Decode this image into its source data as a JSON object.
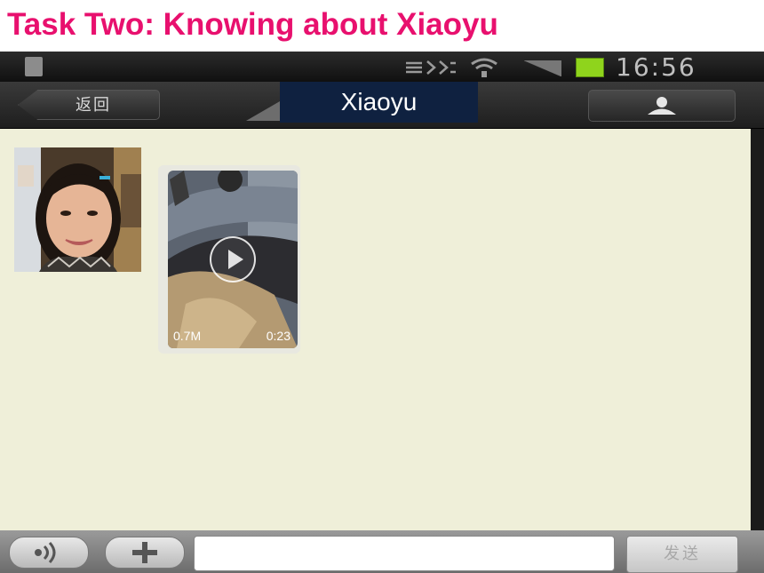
{
  "slide": {
    "title": "Task Two: Knowing about Xiaoyu"
  },
  "status_bar": {
    "time": "16:56"
  },
  "header": {
    "back_label": "返回",
    "contact_name": "Xiaoyu"
  },
  "chat": {
    "video": {
      "size": "0.7M",
      "duration": "0:23"
    }
  },
  "input_bar": {
    "message_value": "",
    "send_label": "发送"
  },
  "colors": {
    "title": "#e8106e",
    "chat_background": "#efefd9",
    "name_background": "#0f2140",
    "battery": "#8fd41c"
  },
  "icons": [
    "sim-card-icon",
    "data-sync-icon",
    "wifi-icon",
    "signal-icon",
    "battery-icon",
    "person-icon",
    "play-icon",
    "voice-icon",
    "plus-icon"
  ]
}
